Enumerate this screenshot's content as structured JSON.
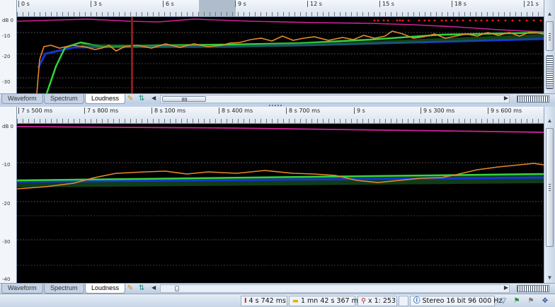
{
  "colors": {
    "peak_line": "#d0209a",
    "momentary": "#e8892a",
    "short_term": "#35d43a",
    "integrated": "#1537d6",
    "clip_marker": "#ff2020",
    "cursor": "#8b1a1a",
    "grid": "#5a5a5a",
    "background": "#000000"
  },
  "top": {
    "ruler_labels": [
      "0 s",
      "3 s",
      "6 s",
      "9 s",
      "12 s",
      "15 s",
      "18 s",
      "21 s"
    ],
    "y_labels": [
      "dB 0",
      "-10",
      "-20",
      "-30"
    ],
    "tabs": [
      "Waveform",
      "Spectrum",
      "Loudness"
    ],
    "active_tab": "Loudness"
  },
  "bottom": {
    "ruler_labels": [
      "7 s 500 ms",
      "7 s 800 ms",
      "8 s 100 ms",
      "8 s 400 ms",
      "8 s 700 ms",
      "9 s",
      "9 s 300 ms",
      "9 s 600 ms"
    ],
    "y_labels": [
      "dB 0",
      "-10",
      "-20",
      "-30",
      "-40"
    ],
    "tabs": [
      "Waveform",
      "Spectrum",
      "Loudness"
    ],
    "active_tab": "Loudness"
  },
  "icons": {
    "wand": "magic-wand-icon",
    "updown": "up-down-arrows-icon",
    "scroll_left": "arrow-left-icon",
    "scroll_right": "arrow-right-icon",
    "scroll_up": "arrow-up-icon",
    "scroll_down": "arrow-down-icon"
  },
  "status": {
    "cursor_position": "4 s 742 ms",
    "duration": "1 mn 42 s 367 ms",
    "zoom": "x 1: 253",
    "format": "Stereo 16 bit 96 000 Hz"
  }
}
